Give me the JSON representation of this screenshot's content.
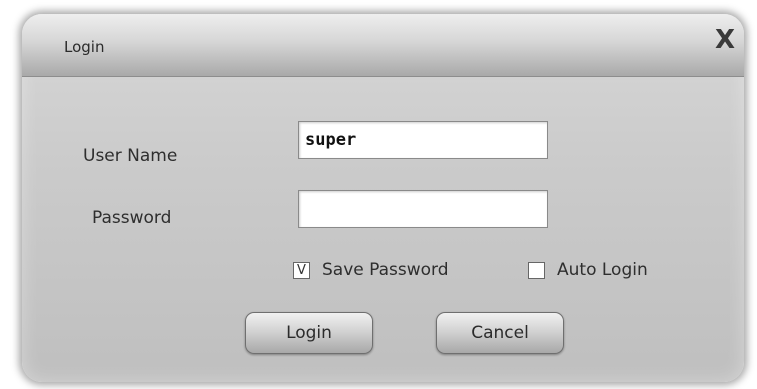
{
  "window": {
    "title": "Login",
    "close_icon": "close-icon",
    "close_glyph": "X"
  },
  "form": {
    "username_label": "User Name",
    "username_value": "super",
    "password_label": "Password",
    "password_value": ""
  },
  "options": {
    "save_password_label": "Save Password",
    "save_password_checked": true,
    "save_password_mark": "V",
    "auto_login_label": "Auto Login",
    "auto_login_checked": false
  },
  "buttons": {
    "login_label": "Login",
    "cancel_label": "Cancel"
  }
}
